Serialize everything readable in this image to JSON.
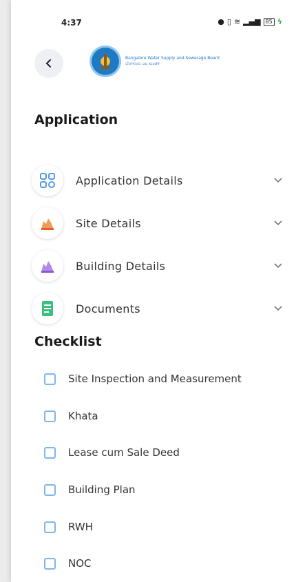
{
  "status_bar": {
    "time": "4:37",
    "battery": "85"
  },
  "header": {
    "back_icon": "chevron-left-icon",
    "org_name_line1": "Bangalore Water Supply and Sewerage Board",
    "org_name_line2": "ಬೆಂಗಳೂರು ಜಲ ಮಂಡಳಿ"
  },
  "application": {
    "title": "Application",
    "items": [
      {
        "label": "Application Details",
        "icon": "grid-icon"
      },
      {
        "label": "Site Details",
        "icon": "site-icon"
      },
      {
        "label": "Building Details",
        "icon": "building-icon"
      },
      {
        "label": "Documents",
        "icon": "document-icon"
      }
    ]
  },
  "checklist": {
    "title": "Checklist",
    "items": [
      {
        "label": "Site Inspection and Measurement",
        "checked": false
      },
      {
        "label": "Khata",
        "checked": false
      },
      {
        "label": "Lease cum Sale Deed",
        "checked": false
      },
      {
        "label": "Building Plan",
        "checked": false
      },
      {
        "label": "RWH",
        "checked": false
      },
      {
        "label": "NOC",
        "checked": false
      }
    ]
  },
  "colors": {
    "accent": "#7fb6ec",
    "brand": "#1f79c3"
  }
}
